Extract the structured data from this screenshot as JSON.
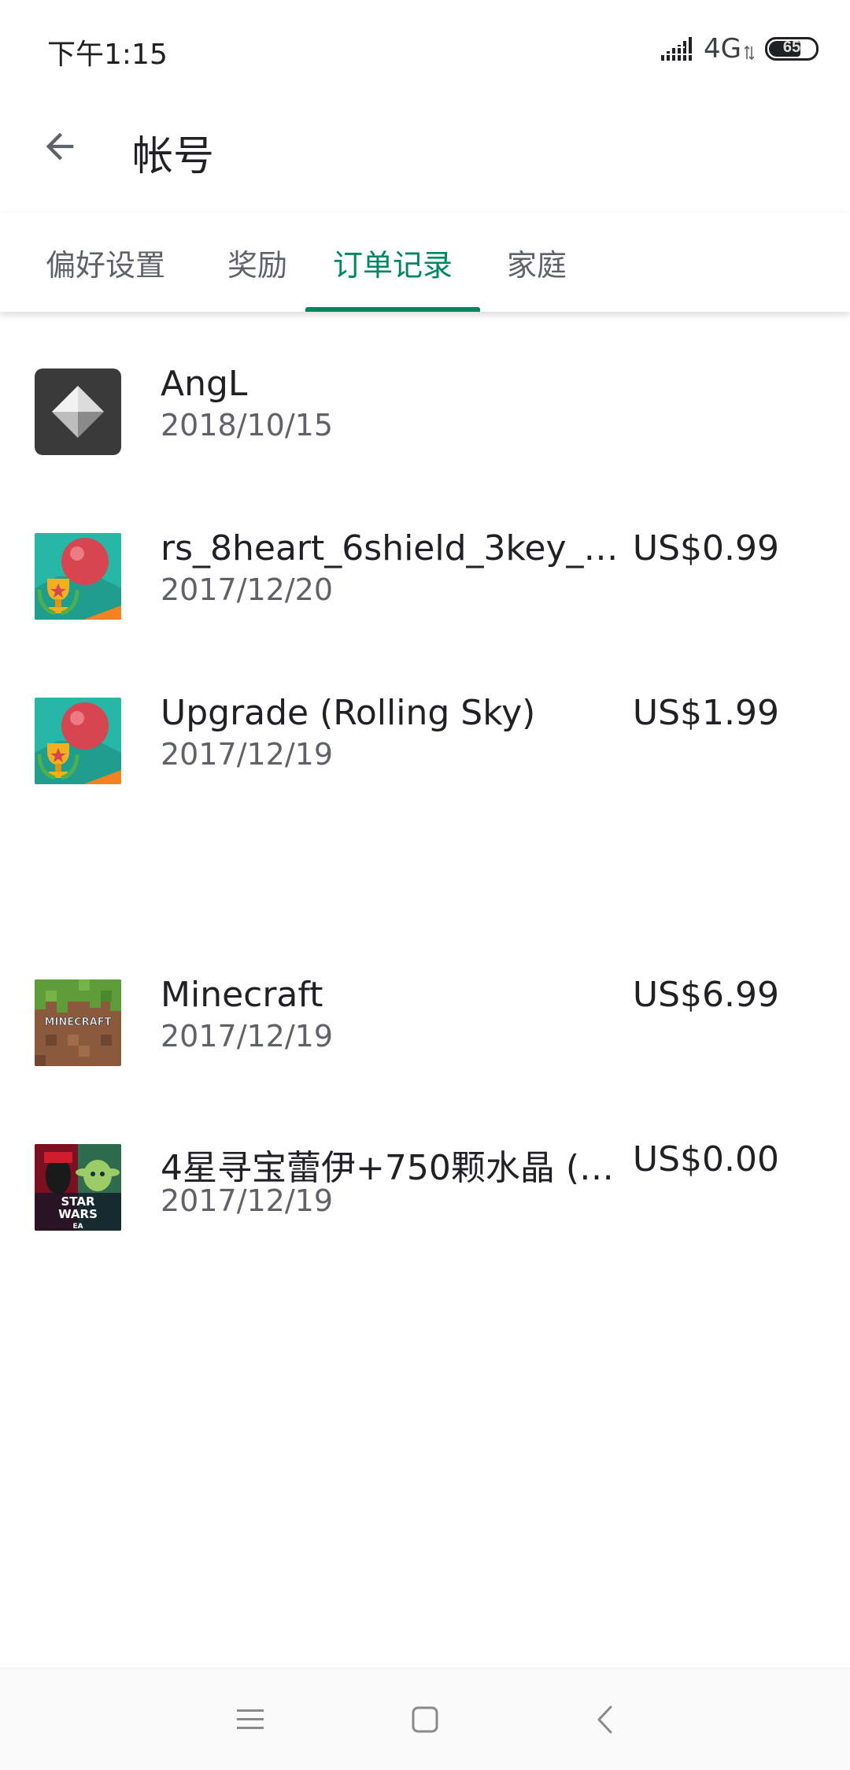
{
  "status_bar": {
    "time": "下午1:15",
    "network": "4G",
    "battery": "65"
  },
  "app_bar": {
    "title": "帐号",
    "back_icon": "arrow-back-icon"
  },
  "tabs": [
    {
      "label": "偏好设置",
      "active": false
    },
    {
      "label": "奖励",
      "active": false
    },
    {
      "label": "订单记录",
      "active": true
    },
    {
      "label": "家庭",
      "active": false
    }
  ],
  "accent_color": "#01875f",
  "orders": [
    {
      "name": "AngL",
      "date": "2018/10/15",
      "price": "",
      "icon": "angl-app-icon"
    },
    {
      "name": "rs_8heart_6shield_3key_50...",
      "date": "2017/12/20",
      "price": "US$0.99",
      "icon": "rolling-sky-app-icon"
    },
    {
      "name": "Upgrade (Rolling Sky)",
      "date": "2017/12/19",
      "price": "US$1.99",
      "icon": "rolling-sky-app-icon"
    },
    {
      "name": "Minecraft",
      "date": "2017/12/19",
      "price": "US$6.99",
      "icon": "minecraft-app-icon"
    },
    {
      "name": "4星寻宝蕾伊+750颗水晶 (星...",
      "date": "2017/12/19",
      "price": "US$0.00",
      "icon": "star-wars-app-icon"
    }
  ],
  "icon_text": {
    "minecraft": "MINECRAFT",
    "star_wars_1": "STAR",
    "star_wars_2": "WARS",
    "star_wars_3": "EA"
  },
  "nav_bar": {
    "menu_icon": "menu-icon",
    "home_icon": "home-square-icon",
    "back_icon": "back-chevron-icon"
  }
}
